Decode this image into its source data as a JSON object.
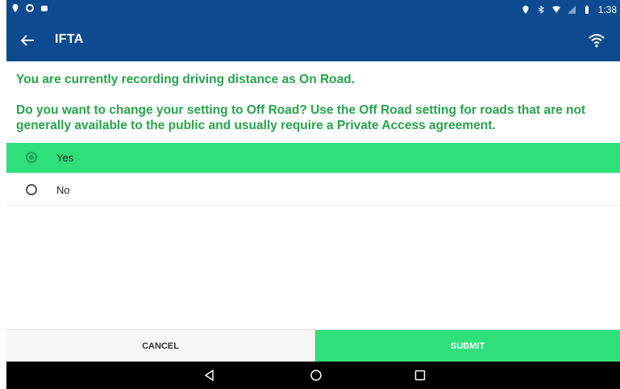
{
  "status_bar": {
    "left_icons": [
      "location-icon",
      "sync-icon",
      "notification-icon"
    ],
    "right_icons": [
      "location-icon",
      "bluetooth-icon",
      "wifi-icon",
      "signal-icon",
      "battery-icon"
    ],
    "time": "1:38"
  },
  "app_bar": {
    "title": "IFTA",
    "back_icon": "arrow-left-icon",
    "right_icon": "wifi-icon",
    "color": "#0d4a8f"
  },
  "messages": {
    "current": "You are currently recording driving distance as On Road.",
    "question": "Do you want to change your setting to Off Road? Use the Off Road setting for roads that are not generally available to the public and usually require a Private Access agreement."
  },
  "options": [
    {
      "label": "Yes",
      "selected": true
    },
    {
      "label": "No",
      "selected": false
    }
  ],
  "buttons": {
    "cancel": "CANCEL",
    "submit": "SUBMIT"
  },
  "colors": {
    "accent_green": "#2fe07a",
    "text_green": "#27a44b"
  },
  "nav_bar": {
    "icons": [
      "back-triangle-icon",
      "home-circle-icon",
      "recents-square-icon"
    ]
  }
}
